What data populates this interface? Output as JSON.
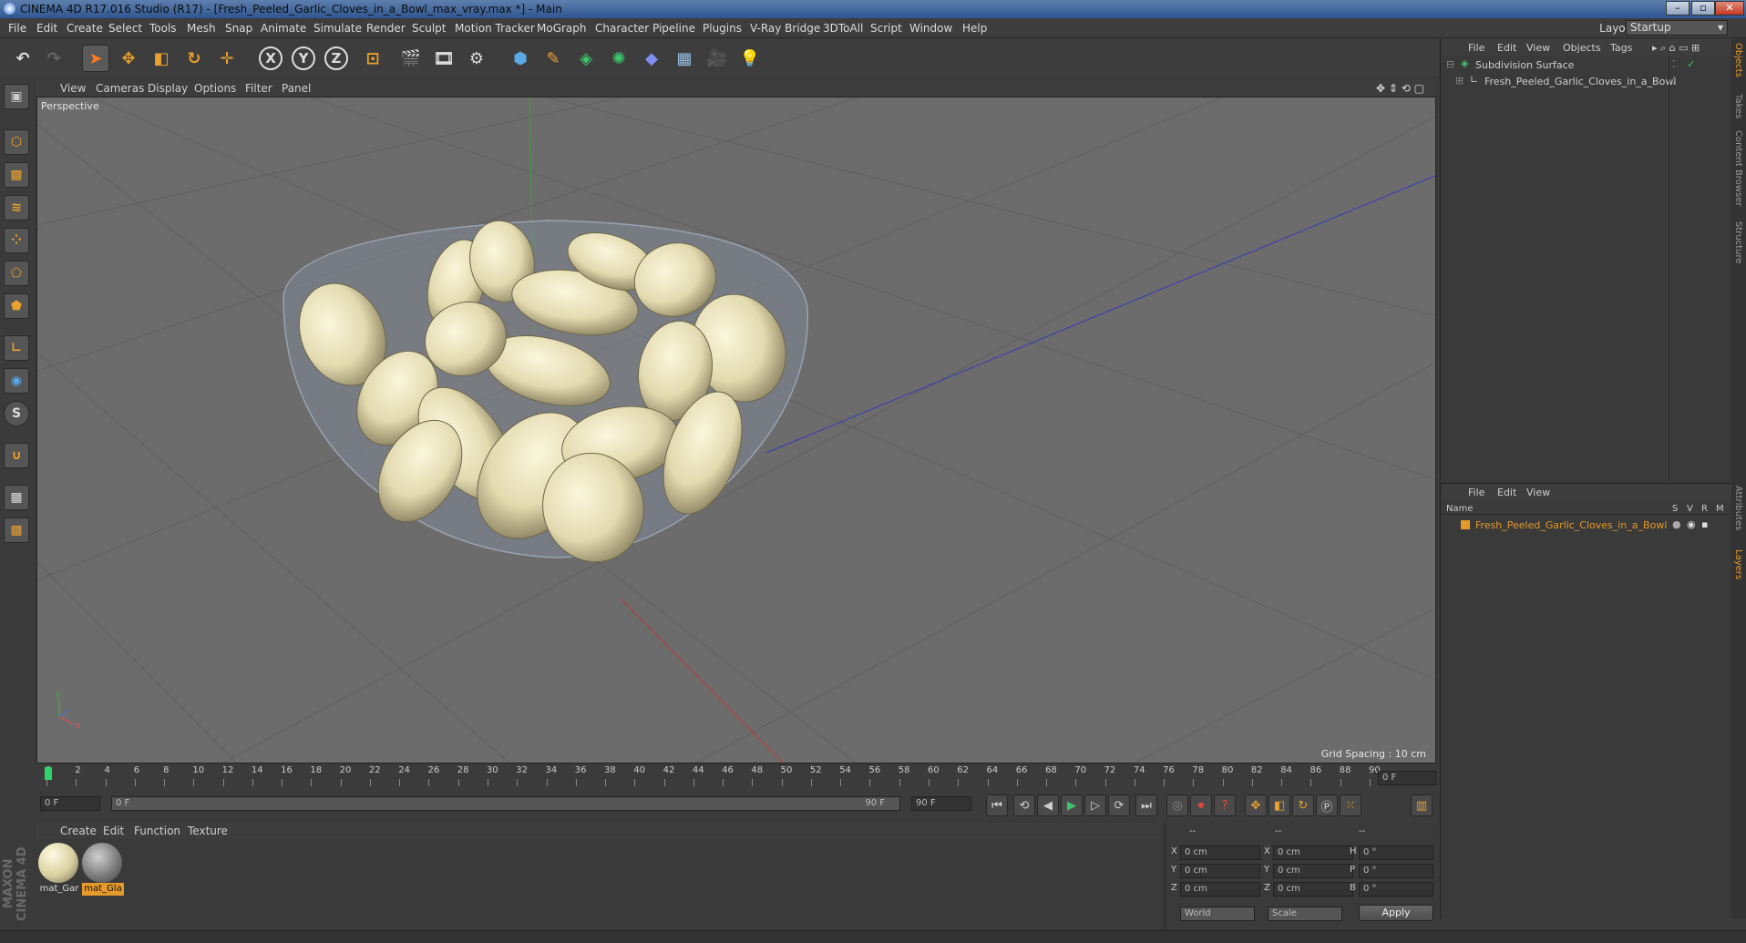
{
  "window": {
    "title": "CINEMA 4D R17.016 Studio (R17) - [Fresh_Peeled_Garlic_Cloves_in_a_Bowl_max_vray.max *] - Main"
  },
  "menu": [
    "File",
    "Edit",
    "Create",
    "Select",
    "Tools",
    "Mesh",
    "Snap",
    "Animate",
    "Simulate",
    "Render",
    "Sculpt",
    "Motion Tracker",
    "MoGraph",
    "Character",
    "Pipeline",
    "Plugins",
    "V-Ray Bridge",
    "3DToAll",
    "Script",
    "Window",
    "Help"
  ],
  "layout": {
    "label": "Layout:",
    "value": "Startup"
  },
  "viewport": {
    "menu": [
      "View",
      "Cameras",
      "Display",
      "Options",
      "Filter",
      "Panel"
    ],
    "camera_label": "Perspective",
    "grid_spacing": "Grid Spacing : 10 cm"
  },
  "timeline": {
    "ticks": [
      "0",
      "2",
      "4",
      "6",
      "8",
      "10",
      "12",
      "14",
      "16",
      "18",
      "20",
      "22",
      "24",
      "26",
      "28",
      "30",
      "32",
      "34",
      "36",
      "38",
      "40",
      "42",
      "44",
      "46",
      "48",
      "50",
      "52",
      "54",
      "56",
      "58",
      "60",
      "62",
      "64",
      "66",
      "68",
      "70",
      "72",
      "74",
      "76",
      "78",
      "80",
      "82",
      "84",
      "86",
      "88",
      "90"
    ],
    "current_frame": "0 F",
    "start_field": "0 F",
    "range_start": "0 F",
    "range_end": "90 F",
    "end_field": "90 F"
  },
  "materials": {
    "menu": [
      "Create",
      "Edit",
      "Function",
      "Texture"
    ],
    "items": [
      {
        "name": "mat_Gar",
        "selected": false
      },
      {
        "name": "mat_Gla",
        "selected": true
      }
    ]
  },
  "coords": {
    "headers": [
      "--",
      "--",
      "--"
    ],
    "rows": [
      {
        "a": "X",
        "av": "0 cm",
        "b": "X",
        "bv": "0 cm",
        "c": "H",
        "cv": "0 °"
      },
      {
        "a": "Y",
        "av": "0 cm",
        "b": "Y",
        "bv": "0 cm",
        "c": "P",
        "cv": "0 °"
      },
      {
        "a": "Z",
        "av": "0 cm",
        "b": "Z",
        "bv": "0 cm",
        "c": "B",
        "cv": "0 °"
      }
    ],
    "space": "World",
    "mode": "Scale",
    "apply": "Apply"
  },
  "object_manager": {
    "menu": [
      "File",
      "Edit",
      "View",
      "Objects",
      "Tags"
    ],
    "objects": [
      {
        "name": "Subdivision Surface",
        "color": "#cfcfcf"
      },
      {
        "name": "Fresh_Peeled_Garlic_Cloves_in_a_Bowl",
        "color": "#cfcfcf"
      }
    ]
  },
  "layer_manager": {
    "menu": [
      "File",
      "Edit",
      "View"
    ],
    "columns": {
      "name": "Name",
      "s": "S",
      "v": "V",
      "r": "R",
      "m": "M"
    },
    "layers": [
      {
        "name": "Fresh_Peeled_Garlic_Cloves_in_a_Bowl",
        "color": "#e59a2b"
      }
    ]
  },
  "side_tabs": [
    "Objects",
    "Takes",
    "Content Browser",
    "Structure",
    "Attributes",
    "Layers"
  ],
  "maxon_logo": "MAXON CINEMA 4D",
  "colors": {
    "accent_orange": "#e59a2b",
    "viewport_bg": "#6c6c6c",
    "timeline_marker": "#2fd36b"
  }
}
